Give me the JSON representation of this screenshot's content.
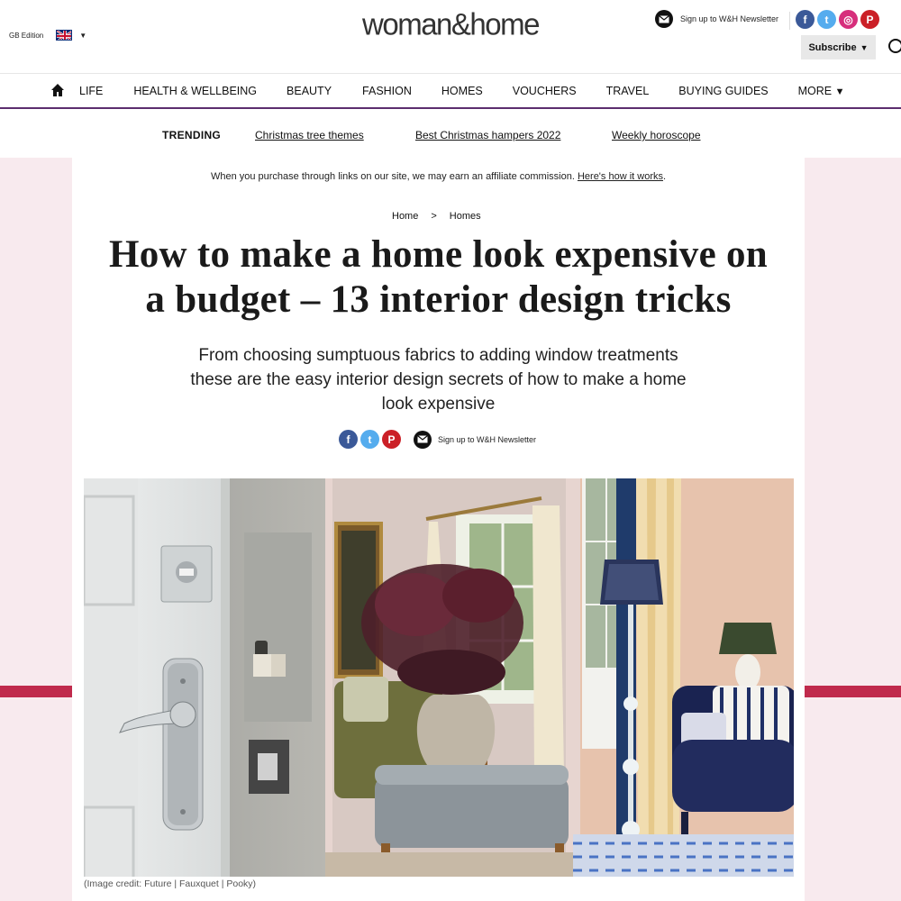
{
  "header": {
    "edition_label": "GB Edition",
    "logo_text": "woman&home",
    "newsletter_label": "Sign up to W&H Newsletter",
    "subscribe_label": "Subscribe",
    "social": [
      "f",
      "t",
      "◎",
      "P"
    ]
  },
  "nav": {
    "items": [
      "LIFE",
      "HEALTH & WELLBEING",
      "BEAUTY",
      "FASHION",
      "HOMES",
      "VOUCHERS",
      "TRAVEL",
      "BUYING GUIDES",
      "MORE"
    ]
  },
  "trending": {
    "label": "TRENDING",
    "links": [
      "Christmas tree themes",
      "Best Christmas hampers 2022",
      "Weekly horoscope"
    ]
  },
  "affiliate": {
    "text": "When you purchase through links on our site, we may earn an affiliate commission.",
    "link": "Here's how it works",
    "period": "."
  },
  "breadcrumb": {
    "home": "Home",
    "sep": ">",
    "section": "Homes"
  },
  "article": {
    "title_line1": "How to make a home look expensive on",
    "title_line2": "a budget – 13 interior design tricks",
    "standfirst_line1": "From choosing sumptuous fabrics to adding window treatments",
    "standfirst_line2": "these are the easy interior design secrets of how to make a home",
    "standfirst_line3": "look expensive",
    "share_newsletter_label": "Sign up to W&H Newsletter",
    "image_caption": "(Image credit: Future | Fauxquet | Pooky)"
  },
  "colors": {
    "accent_purple": "#5c2d6e",
    "accent_pink": "#c02a4c",
    "bg_pink": "#f8eaee"
  }
}
